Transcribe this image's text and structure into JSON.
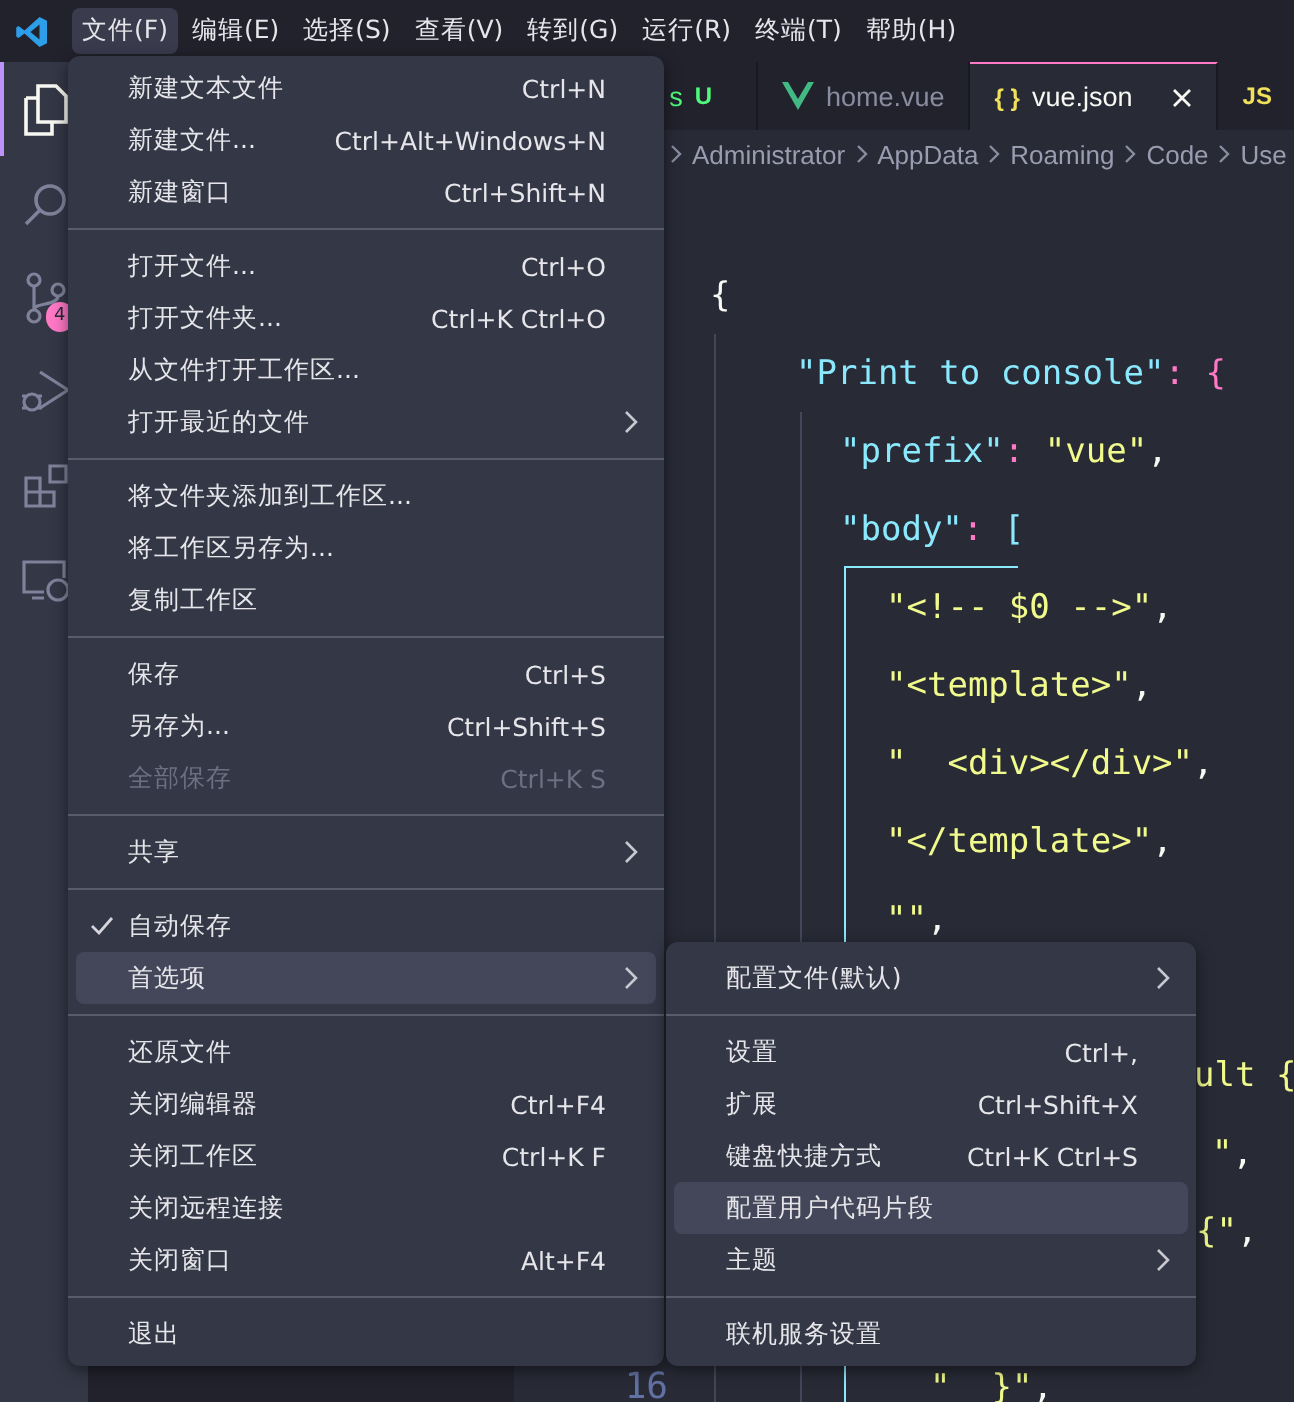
{
  "menu_bar": {
    "items": [
      {
        "label": "文件(F)",
        "selected": true
      },
      {
        "label": "编辑(E)",
        "selected": false
      },
      {
        "label": "选择(S)",
        "selected": false
      },
      {
        "label": "查看(V)",
        "selected": false
      },
      {
        "label": "转到(G)",
        "selected": false
      },
      {
        "label": "运行(R)",
        "selected": false
      },
      {
        "label": "终端(T)",
        "selected": false
      },
      {
        "label": "帮助(H)",
        "selected": false
      }
    ]
  },
  "activity_bar": {
    "items": [
      {
        "kind": "files",
        "selected": true
      },
      {
        "kind": "search",
        "selected": false
      },
      {
        "kind": "source-control",
        "selected": false,
        "badge": "4"
      },
      {
        "kind": "run",
        "selected": false
      },
      {
        "kind": "extensions",
        "selected": false
      },
      {
        "kind": "remote",
        "selected": false
      }
    ]
  },
  "tabs": [
    {
      "label": "s",
      "status": "U",
      "selected": false
    },
    {
      "kind": "vue",
      "label": "home.vue",
      "selected": false
    },
    {
      "kind": "glyph",
      "icon_text": "{ }",
      "label": "vue.json",
      "selected": true
    },
    {
      "kind": "glyph",
      "icon_text": "JS",
      "selected": false
    }
  ],
  "breadcrumb": [
    "Administrator",
    "AppData",
    "Roaming",
    "Code",
    "Use"
  ],
  "editor": {
    "lines": [
      {
        "tokens": [
          {
            "text": "{",
            "kind": "plain"
          }
        ],
        "children": [
          {
            "tokens": [
              {
                "text": "\"Print to console\"",
                "kind": "key"
              },
              {
                "text": ": ",
                "kind": "colon"
              },
              {
                "text": "{",
                "kind": "brace"
              }
            ],
            "children": [
              {
                "tokens": [
                  {
                    "text": "\"prefix\"",
                    "kind": "key"
                  },
                  {
                    "text": ": ",
                    "kind": "colon"
                  },
                  {
                    "text": "\"vue\"",
                    "kind": "string"
                  },
                  {
                    "text": ",",
                    "kind": "plain"
                  }
                ]
              },
              {
                "tokens": [
                  {
                    "text": "\"body\"",
                    "kind": "key"
                  },
                  {
                    "text": ": ",
                    "kind": "colon"
                  },
                  {
                    "text": "[",
                    "kind": "bracket"
                  }
                ],
                "children": [
                  {
                    "tokens": [
                      {
                        "text": "\"<!-- $0 -->\"",
                        "kind": "string"
                      },
                      {
                        "text": ",",
                        "kind": "plain"
                      }
                    ]
                  },
                  {
                    "tokens": [
                      {
                        "text": "\"<template>\"",
                        "kind": "string"
                      },
                      {
                        "text": ",",
                        "kind": "plain"
                      }
                    ]
                  },
                  {
                    "tokens": [
                      {
                        "text": "\"  <div></div>\"",
                        "kind": "string"
                      },
                      {
                        "text": ",",
                        "kind": "plain"
                      }
                    ]
                  },
                  {
                    "tokens": [
                      {
                        "text": "\"</template>\"",
                        "kind": "string"
                      },
                      {
                        "text": ",",
                        "kind": "plain"
                      }
                    ]
                  },
                  {
                    "tokens": [
                      {
                        "text": "\"\"",
                        "kind": "string"
                      },
                      {
                        "text": ",",
                        "kind": "plain"
                      }
                    ]
                  }
                ]
              }
            ]
          }
        ]
      }
    ],
    "fragments": [
      {
        "tokens": [
          {
            "text": "ult {",
            "kind": "string"
          }
        ]
      },
      {
        "tokens": [
          {
            "text": "\"",
            "kind": "string"
          },
          {
            "text": ",",
            "kind": "plain"
          }
        ]
      },
      {
        "tokens": [
          {
            "text": "{\"",
            "kind": "string"
          },
          {
            "text": ",",
            "kind": "plain"
          }
        ]
      },
      {
        "tokens": [
          {
            "text": "\"  }\"",
            "kind": "string"
          },
          {
            "text": ",",
            "kind": "plain"
          }
        ]
      }
    ],
    "line_number": "16"
  },
  "file_menu": {
    "items": [
      {
        "kind": "item",
        "label": "新建文本文件",
        "shortcut": "Ctrl+N",
        "submenu": false,
        "checked": false,
        "disabled": false,
        "selected": false
      },
      {
        "kind": "item",
        "label": "新建文件...",
        "shortcut": "Ctrl+Alt+Windows+N",
        "submenu": false,
        "checked": false,
        "disabled": false,
        "selected": false
      },
      {
        "kind": "item",
        "label": "新建窗口",
        "shortcut": "Ctrl+Shift+N",
        "submenu": false,
        "checked": false,
        "disabled": false,
        "selected": false
      },
      {
        "kind": "separator"
      },
      {
        "kind": "item",
        "label": "打开文件...",
        "shortcut": "Ctrl+O",
        "submenu": false,
        "checked": false,
        "disabled": false,
        "selected": false
      },
      {
        "kind": "item",
        "label": "打开文件夹...",
        "shortcut": "Ctrl+K Ctrl+O",
        "submenu": false,
        "checked": false,
        "disabled": false,
        "selected": false
      },
      {
        "kind": "item",
        "label": "从文件打开工作区...",
        "submenu": false,
        "checked": false,
        "disabled": false,
        "selected": false
      },
      {
        "kind": "item",
        "label": "打开最近的文件",
        "submenu": true,
        "checked": false,
        "disabled": false,
        "selected": false
      },
      {
        "kind": "separator"
      },
      {
        "kind": "item",
        "label": "将文件夹添加到工作区...",
        "submenu": false,
        "checked": false,
        "disabled": false,
        "selected": false
      },
      {
        "kind": "item",
        "label": "将工作区另存为...",
        "submenu": false,
        "checked": false,
        "disabled": false,
        "selected": false
      },
      {
        "kind": "item",
        "label": "复制工作区",
        "submenu": false,
        "checked": false,
        "disabled": false,
        "selected": false
      },
      {
        "kind": "separator"
      },
      {
        "kind": "item",
        "label": "保存",
        "shortcut": "Ctrl+S",
        "submenu": false,
        "checked": false,
        "disabled": false,
        "selected": false
      },
      {
        "kind": "item",
        "label": "另存为...",
        "shortcut": "Ctrl+Shift+S",
        "submenu": false,
        "checked": false,
        "disabled": false,
        "selected": false
      },
      {
        "kind": "item",
        "label": "全部保存",
        "shortcut": "Ctrl+K S",
        "submenu": false,
        "checked": false,
        "disabled": true,
        "selected": false
      },
      {
        "kind": "separator"
      },
      {
        "kind": "item",
        "label": "共享",
        "submenu": true,
        "checked": false,
        "disabled": false,
        "selected": false
      },
      {
        "kind": "separator"
      },
      {
        "kind": "item",
        "label": "自动保存",
        "submenu": false,
        "checked": true,
        "disabled": false,
        "selected": false
      },
      {
        "kind": "item",
        "label": "首选项",
        "submenu": true,
        "checked": false,
        "disabled": false,
        "selected": true
      },
      {
        "kind": "separator"
      },
      {
        "kind": "item",
        "label": "还原文件",
        "submenu": false,
        "checked": false,
        "disabled": false,
        "selected": false
      },
      {
        "kind": "item",
        "label": "关闭编辑器",
        "shortcut": "Ctrl+F4",
        "submenu": false,
        "checked": false,
        "disabled": false,
        "selected": false
      },
      {
        "kind": "item",
        "label": "关闭工作区",
        "shortcut": "Ctrl+K F",
        "submenu": false,
        "checked": false,
        "disabled": false,
        "selected": false
      },
      {
        "kind": "item",
        "label": "关闭远程连接",
        "submenu": false,
        "checked": false,
        "disabled": false,
        "selected": false
      },
      {
        "kind": "item",
        "label": "关闭窗口",
        "shortcut": "Alt+F4",
        "submenu": false,
        "checked": false,
        "disabled": false,
        "selected": false
      },
      {
        "kind": "separator"
      },
      {
        "kind": "item",
        "label": "退出",
        "submenu": false,
        "checked": false,
        "disabled": false,
        "selected": false
      }
    ]
  },
  "preferences_submenu": {
    "items": [
      {
        "kind": "item",
        "label": "配置文件(默认)",
        "submenu": true,
        "checked": false,
        "disabled": false,
        "selected": false
      },
      {
        "kind": "separator"
      },
      {
        "kind": "item",
        "label": "设置",
        "shortcut": "Ctrl+,",
        "submenu": false,
        "checked": false,
        "disabled": false,
        "selected": false
      },
      {
        "kind": "item",
        "label": "扩展",
        "shortcut": "Ctrl+Shift+X",
        "submenu": false,
        "checked": false,
        "disabled": false,
        "selected": false
      },
      {
        "kind": "item",
        "label": "键盘快捷方式",
        "shortcut": "Ctrl+K Ctrl+S",
        "submenu": false,
        "checked": false,
        "disabled": false,
        "selected": false
      },
      {
        "kind": "item",
        "label": "配置用户代码片段",
        "submenu": false,
        "checked": false,
        "disabled": false,
        "selected": true
      },
      {
        "kind": "item",
        "label": "主题",
        "submenu": true,
        "checked": false,
        "disabled": false,
        "selected": false
      },
      {
        "kind": "separator"
      },
      {
        "kind": "item",
        "label": "联机服务设置",
        "submenu": false,
        "checked": false,
        "disabled": false,
        "selected": false
      }
    ]
  }
}
